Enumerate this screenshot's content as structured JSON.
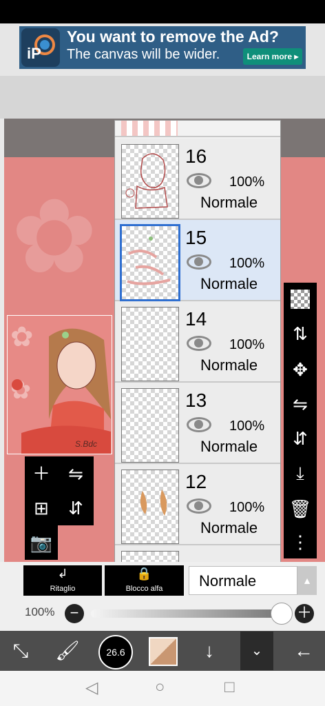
{
  "ad": {
    "logo_text": "iP",
    "title": "You want to remove the Ad?",
    "subtitle": "The canvas will be wider.",
    "button": "Learn more ▸"
  },
  "layers": [
    {
      "number": "16",
      "opacity": "100%",
      "blend": "Normale",
      "selected": false
    },
    {
      "number": "15",
      "opacity": "100%",
      "blend": "Normale",
      "selected": true
    },
    {
      "number": "14",
      "opacity": "100%",
      "blend": "Normale",
      "selected": false
    },
    {
      "number": "13",
      "opacity": "100%",
      "blend": "Normale",
      "selected": false
    },
    {
      "number": "12",
      "opacity": "100%",
      "blend": "Normale",
      "selected": false
    }
  ],
  "bottom": {
    "ritaglio_label": "Ritaglio",
    "blocco_label": "Blocco alfa",
    "blend_mode": "Normale",
    "opacity_label": "100%",
    "opacity_value": 1.0
  },
  "toolbar": {
    "brush_size": "26.6"
  },
  "preview": {
    "signature": "S.Bdc"
  },
  "colors": {
    "canvas": "#e28784",
    "selected_layer": "#dce7f6",
    "selection_border": "#2f6fd0",
    "toolbar": "#4d4d4d",
    "primary_color": "#c99772"
  }
}
